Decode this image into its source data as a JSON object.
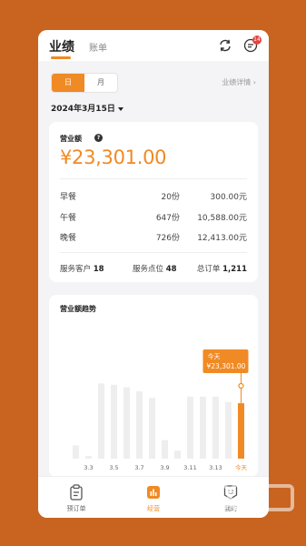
{
  "colors": {
    "accent": "#F08A24",
    "background": "#C8641F"
  },
  "header": {
    "tabs": [
      {
        "label": "业绩",
        "active": true
      },
      {
        "label": "账单",
        "active": false
      }
    ],
    "notification_count": "14",
    "icons": [
      "refresh-icon",
      "message-icon"
    ]
  },
  "filter": {
    "segments": [
      {
        "label": "日",
        "active": true
      },
      {
        "label": "月",
        "active": false
      }
    ],
    "detail_link": "业绩详情 ›",
    "date": "2024年3月15日"
  },
  "summary": {
    "revenue_label": "营业额",
    "revenue_help": "?",
    "revenue_value": "¥23,301.00",
    "meals": [
      {
        "name": "早餐",
        "count": "20份",
        "amount": "300.00元"
      },
      {
        "name": "午餐",
        "count": "647份",
        "amount": "10,588.00元"
      },
      {
        "name": "晚餐",
        "count": "726份",
        "amount": "12,413.00元"
      }
    ],
    "stats": {
      "customers_label": "服务客户",
      "customers_value": "18",
      "points_label": "服务点位",
      "points_value": "48",
      "orders_label": "总订单",
      "orders_value": "1,211"
    }
  },
  "trend": {
    "title": "营业额趋势",
    "tooltip_line1": "今天",
    "tooltip_line2": "¥23,301.00"
  },
  "chart_data": {
    "type": "bar",
    "categories": [
      "3.2",
      "3.3",
      "3.4",
      "3.5",
      "3.6",
      "3.7",
      "3.8",
      "3.9",
      "3.10",
      "3.11",
      "3.12",
      "3.13",
      "3.14",
      "今天"
    ],
    "tick_labels": [
      "3.3",
      "3.5",
      "3.7",
      "3.9",
      "3.11",
      "3.13",
      "今天"
    ],
    "values": [
      0.1,
      0.02,
      0.57,
      0.56,
      0.54,
      0.51,
      0.46,
      0.14,
      0.06,
      0.47,
      0.47,
      0.47,
      0.43,
      0.42
    ],
    "value_scale": "relative",
    "highlight_index": 13,
    "highlight_value": "¥23,301.00",
    "ylim": [
      0,
      1
    ]
  },
  "bottom_nav": [
    {
      "label": "预订单",
      "icon": "clipboard-icon",
      "active": false
    },
    {
      "label": "经营",
      "icon": "bar-chart-icon",
      "active": true
    },
    {
      "label": "我的",
      "icon": "profile-icon",
      "active": false
    }
  ]
}
